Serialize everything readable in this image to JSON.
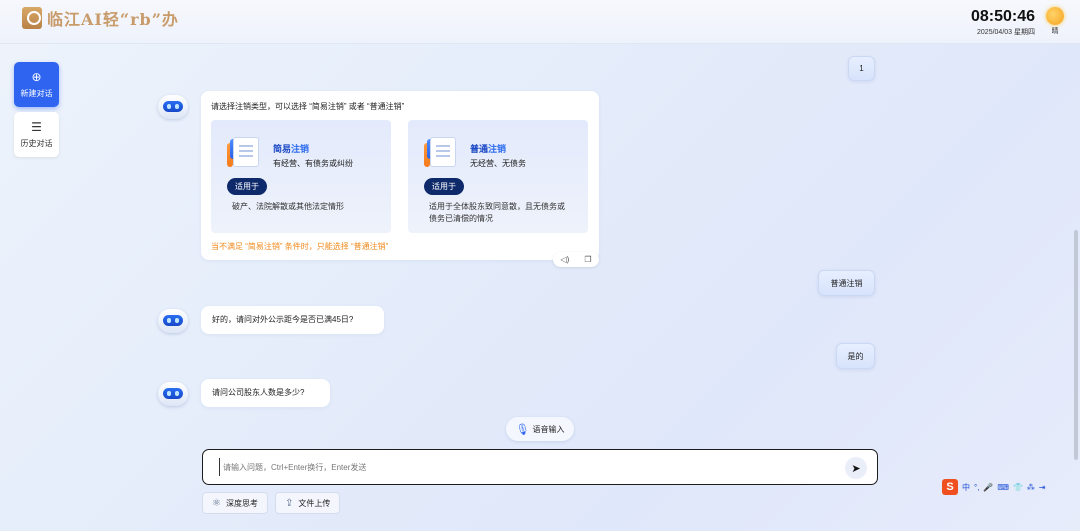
{
  "header": {
    "logo_text": "临江AI轻“rb”办",
    "time": "08:50:46",
    "date": "2025/04/03 星期四",
    "weather": "晴"
  },
  "sidebar": {
    "new_chat": "新建对话",
    "history": "历史对话"
  },
  "messages": {
    "user_1": "1",
    "bot_1": {
      "prompt": "请选择注销类型，可以选择 “简易注销” 或者 “普通注销”",
      "cards": [
        {
          "title_a": "简易",
          "title_b": "注销",
          "subtitle": "有经营、有债务或纠纷",
          "pill": "适用于",
          "desc": "破产、法院解散或其他法定情形"
        },
        {
          "title_a": "普通",
          "title_b": "注销",
          "subtitle": "无经营、无债务",
          "pill": "适用于",
          "desc": "适用于全体股东致同意散，且无债务或债务已清偿的情况"
        }
      ],
      "note": "当不满足 “简易注销” 条件时，只能选择 “普通注销”",
      "action_icons": [
        "speaker-icon",
        "copy-icon"
      ]
    },
    "user_2": "普通注销",
    "bot_2": "好的，请问对外公示距今是否已满45日?",
    "user_3": "是的",
    "bot_3": "请问公司股东人数是多少?"
  },
  "voice_input": "语音输入",
  "input": {
    "placeholder": "请输入问题，Ctrl+Enter换行，Enter发送",
    "value": ""
  },
  "tools": {
    "deep_think": "深度思考",
    "upload": "文件上传"
  },
  "ime": {
    "logo": "S",
    "items": [
      "中",
      "°,",
      "🎤",
      "⌨",
      "👕",
      "⁂",
      "⇥"
    ]
  },
  "colors": {
    "accent": "#2e64f0",
    "pill": "#0e2a6b",
    "note": "#f08a1c",
    "logo": "#c89b6a"
  }
}
